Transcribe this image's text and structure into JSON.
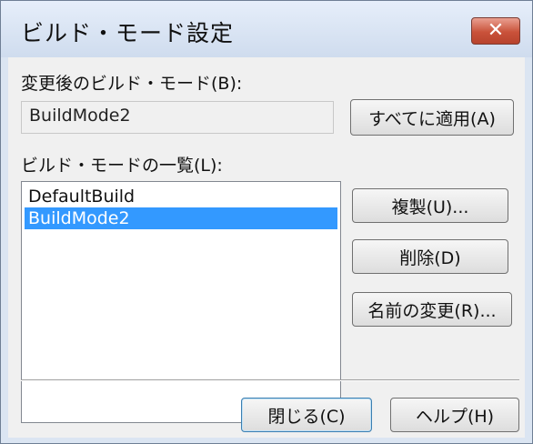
{
  "window": {
    "title": "ビルド・モード設定",
    "close_glyph": "✕"
  },
  "target_mode": {
    "label": "変更後のビルド・モード(B):",
    "value": "BuildMode2",
    "apply_all_label": "すべてに適用(A)"
  },
  "mode_list": {
    "label": "ビルド・モードの一覧(L):",
    "items": [
      {
        "text": "DefaultBuild",
        "selected": false
      },
      {
        "text": "BuildMode2",
        "selected": true
      }
    ]
  },
  "side_buttons": {
    "duplicate": "複製(U)...",
    "delete": "削除(D)",
    "rename": "名前の変更(R)..."
  },
  "footer": {
    "close": "閉じる(C)",
    "help": "ヘルプ(H)"
  },
  "colors": {
    "selection": "#3399ff",
    "close_button": "#c9523a",
    "title_bar": "#dbe5f2"
  }
}
